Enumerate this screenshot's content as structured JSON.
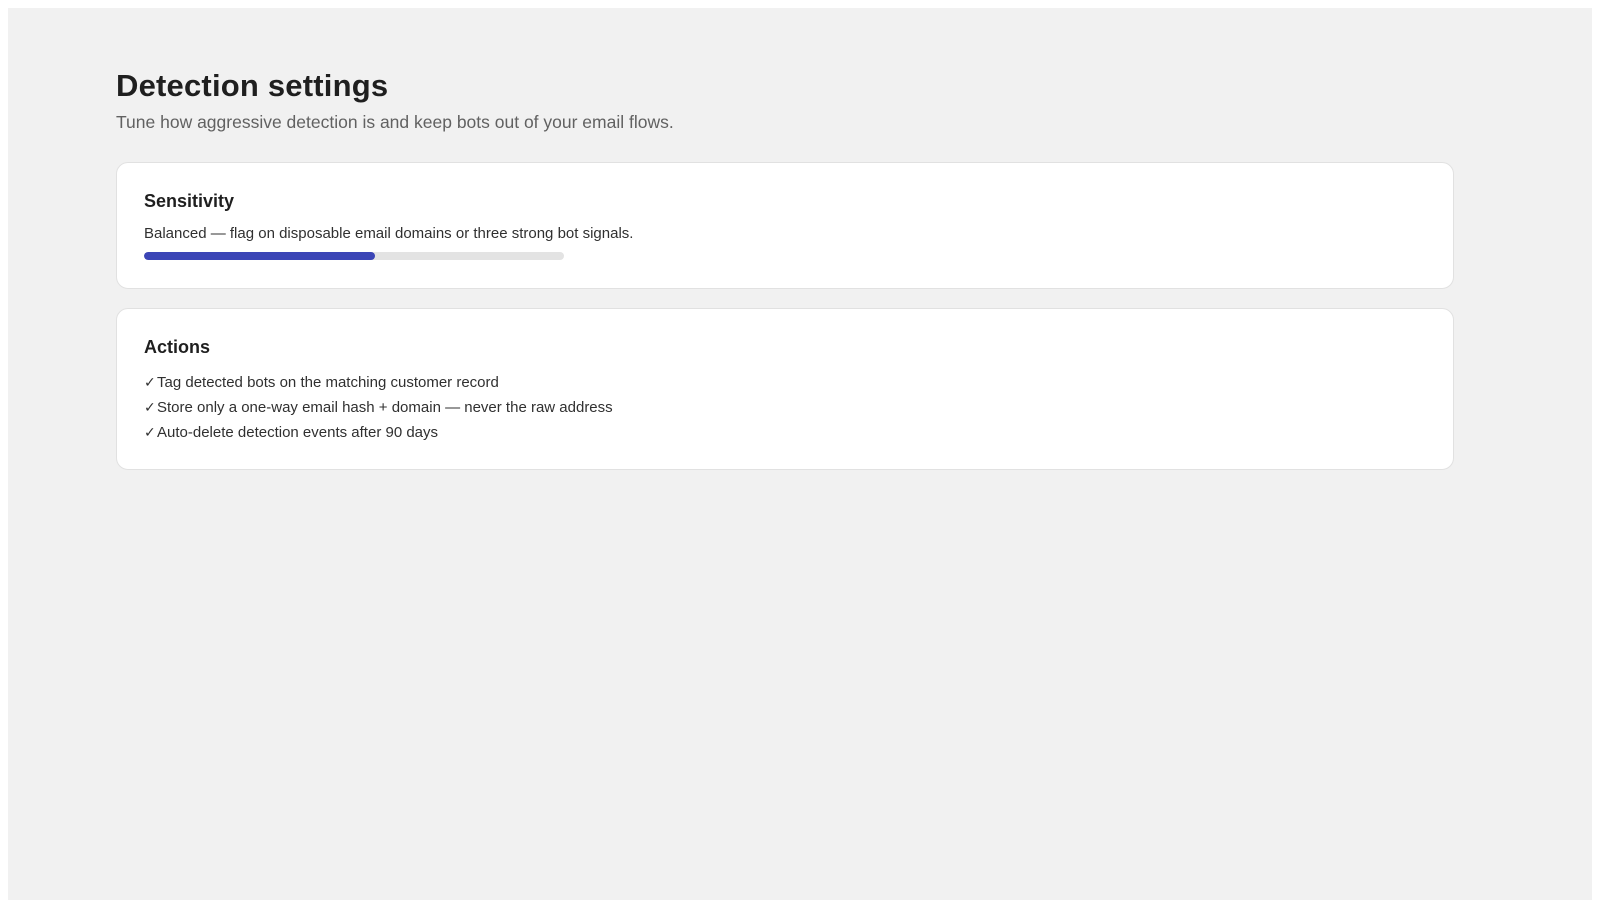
{
  "header": {
    "title": "Detection settings",
    "subtitle": "Tune how aggressive detection is and keep bots out of your email flows."
  },
  "sensitivity": {
    "title": "Sensitivity",
    "description": "Balanced — flag on disposable email domains or three strong bot signals.",
    "level_fraction": 0.55,
    "accent_color": "#3b45b6"
  },
  "actions": {
    "title": "Actions",
    "check_glyph": "✓",
    "items": [
      {
        "label": "Tag detected bots on the matching customer record"
      },
      {
        "label": "Store only a one-way email hash + domain — never the raw address"
      },
      {
        "label": "Auto-delete detection events after 90 days"
      }
    ]
  }
}
